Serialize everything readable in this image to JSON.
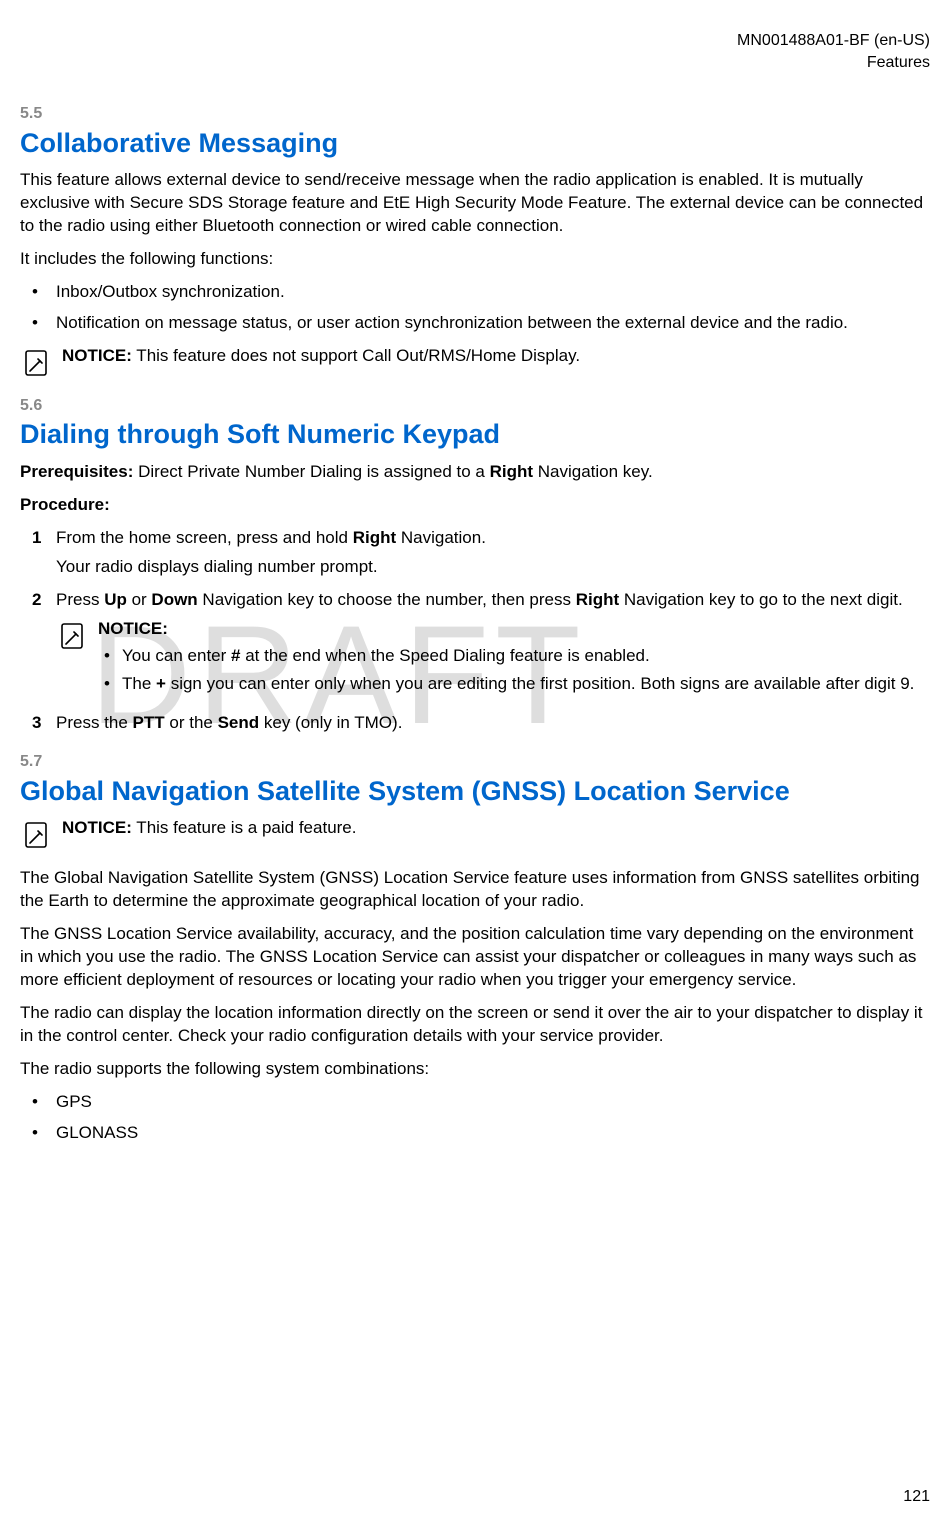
{
  "header": {
    "doc_id": "MN001488A01-BF (en-US)",
    "section": "Features"
  },
  "watermark": "DRAFT",
  "section55": {
    "number": "5.5",
    "title": "Collaborative Messaging",
    "para1": "This feature allows external device to send/receive message when the radio application is enabled. It is mutually exclusive with Secure SDS Storage feature and EtE High Security Mode Feature. The external device can be connected to the radio using either Bluetooth connection or wired cable connection.",
    "para2": "It includes the following functions:",
    "bullets": [
      "Inbox/Outbox synchronization.",
      "Notification on message status, or user action synchronization between the external device and the radio."
    ],
    "notice_label": "NOTICE:",
    "notice_text": " This feature does not support Call Out/RMS/Home Display."
  },
  "section56": {
    "number": "5.6",
    "title": "Dialing through Soft Numeric Keypad",
    "prereq_label": "Prerequisites:",
    "prereq_text_a": " Direct Private Number Dialing is assigned to a ",
    "prereq_bold": "Right",
    "prereq_text_b": " Navigation key.",
    "procedure_label": "Procedure:",
    "steps": {
      "s1a": "From the home screen, press and hold ",
      "s1b": "Right",
      "s1c": " Navigation.",
      "s1_sub": "Your radio displays dialing number prompt.",
      "s2a": "Press ",
      "s2b": "Up",
      "s2c": " or ",
      "s2d": "Down",
      "s2e": " Navigation key to choose the number, then press ",
      "s2f": "Right",
      "s2g": " Navigation key to go to the next digit.",
      "s2_notice_label": "NOTICE:",
      "s2_bullet1a": "You can enter ",
      "s2_bullet1b": "#",
      "s2_bullet1c": " at the end when the Speed Dialing feature is enabled.",
      "s2_bullet2a": "The ",
      "s2_bullet2b": "+",
      "s2_bullet2c": " sign you can enter only when you are editing the first position. Both signs are available after digit 9.",
      "s3a": "Press the ",
      "s3b": "PTT",
      "s3c": " or the ",
      "s3d": "Send",
      "s3e": " key (only in TMO)."
    }
  },
  "section57": {
    "number": "5.7",
    "title": "Global Navigation Satellite System (GNSS) Location Service",
    "notice_label": "NOTICE:",
    "notice_text": " This feature is a paid feature.",
    "para1": "The Global Navigation Satellite System (GNSS) Location Service feature uses information from GNSS satellites orbiting the Earth to determine the approximate geographical location of your radio.",
    "para2": "The GNSS Location Service availability, accuracy, and the position calculation time vary depending on the environment in which you use the radio. The GNSS Location Service can assist your dispatcher or colleagues in many ways such as more efficient deployment of resources or locating your radio when you trigger your emergency service.",
    "para3": "The radio can display the location information directly on the screen or send it over the air to your dispatcher to display it in the control center. Check your radio configuration details with your service provider.",
    "para4": "The radio supports the following system combinations:",
    "bullets": [
      "GPS",
      "GLONASS"
    ]
  },
  "page_number": "121"
}
